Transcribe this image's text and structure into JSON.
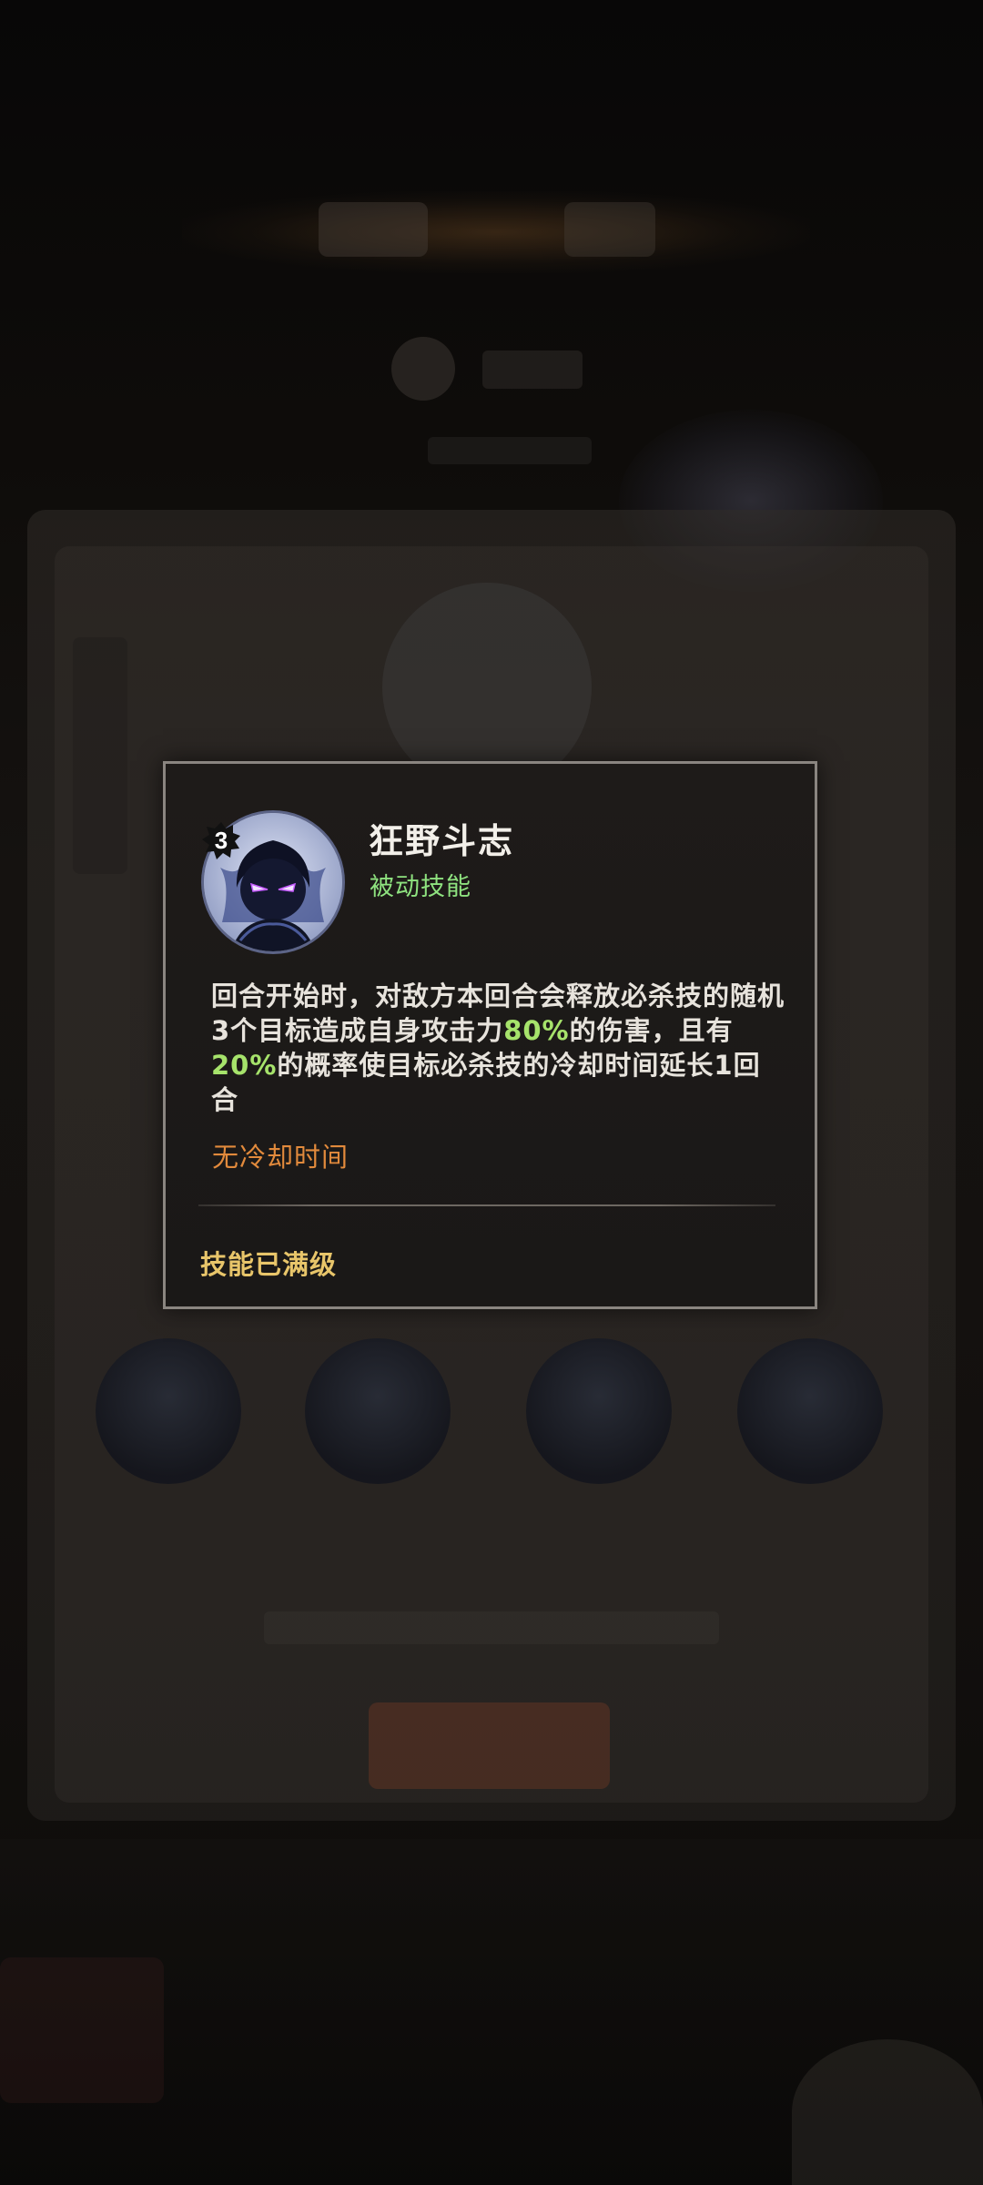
{
  "skill_tooltip": {
    "level": "3",
    "name": "狂野斗志",
    "type_label": "被动技能",
    "description": {
      "part1": "回合开始时，对敌方本回合会释放必杀技的随机3个目标造成自身攻击力",
      "highlight1": "80%",
      "part2": "的伤害，且有",
      "highlight2": "20%",
      "part3": "的概率使目标必杀技的冷却时间延长1回合"
    },
    "cooldown_text": "无冷却时间",
    "max_level_text": "技能已满级"
  },
  "colors": {
    "skill_type": "#8ee27f",
    "highlight": "#a6e36b",
    "cooldown": "#e28a3c",
    "max_level": "#e8c56a",
    "border": "#8a8580"
  },
  "icons": {
    "avatar": "shadow-hero-avatar-icon",
    "level_badge": "level-splat-badge-icon"
  }
}
